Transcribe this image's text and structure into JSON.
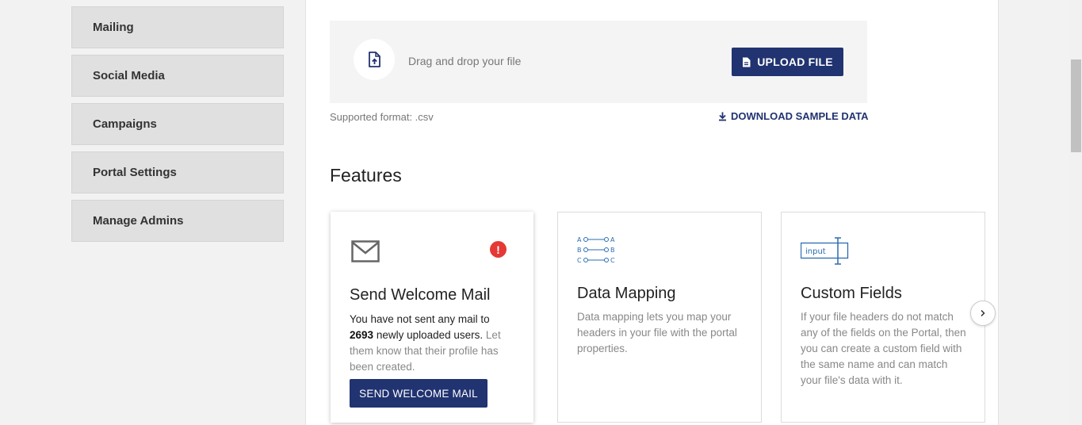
{
  "sidebar": {
    "items": [
      {
        "label": "Mailing"
      },
      {
        "label": "Social Media"
      },
      {
        "label": "Campaigns"
      },
      {
        "label": "Portal Settings"
      },
      {
        "label": "Manage Admins"
      }
    ]
  },
  "upload": {
    "drag_text": "Drag and drop your file",
    "button_label": "UPLOAD FILE",
    "supported_format": "Supported format: .csv",
    "download_label": "DOWNLOAD SAMPLE DATA"
  },
  "features": {
    "title": "Features",
    "cards": [
      {
        "title": "Send Welcome Mail",
        "text_a": "You have not sent any mail to",
        "count": "2693",
        "text_b": "newly uploaded users.",
        "text_c": "Let them know that their profile has been created.",
        "button_label": "SEND WELCOME MAIL",
        "badge": "!"
      },
      {
        "title": "Data Mapping",
        "text": "Data mapping lets you map your headers in your file with the portal properties.",
        "icon_letters": [
          "A",
          "B",
          "C"
        ]
      },
      {
        "title": "Custom Fields",
        "text": "If your file headers do not match any of the fields on the Portal, then you can create a custom field with the same name and can match your file's data with it.",
        "icon_label": "input"
      }
    ]
  },
  "colors": {
    "brand": "#213370",
    "alert": "#e53935"
  },
  "icons": {
    "upload": "file-upload-icon",
    "download": "download-icon",
    "mail": "mail-icon",
    "next": "chevron-right-icon"
  }
}
